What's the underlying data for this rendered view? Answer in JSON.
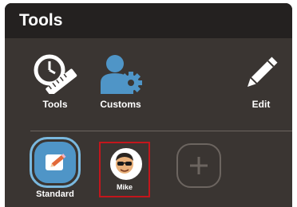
{
  "header": {
    "title": "Tools"
  },
  "tools": {
    "tools_label": "Tools",
    "customs_label": "Customs",
    "edit_label": "Edit"
  },
  "profiles": {
    "standard_label": "Standard",
    "mike_label": "Mike",
    "selected": "Mike"
  },
  "colors": {
    "panel_bg": "#3a3532",
    "header_bg": "#242120",
    "accent_blue": "#4f95c7",
    "selection_red": "#c3161c"
  },
  "icons": {
    "tools": "gauge-ruler-icon",
    "customs": "user-gear-icon",
    "edit": "pencil-icon",
    "standard": "note-pencil-icon",
    "mike": "avatar-face-icon",
    "add": "plus-icon"
  }
}
